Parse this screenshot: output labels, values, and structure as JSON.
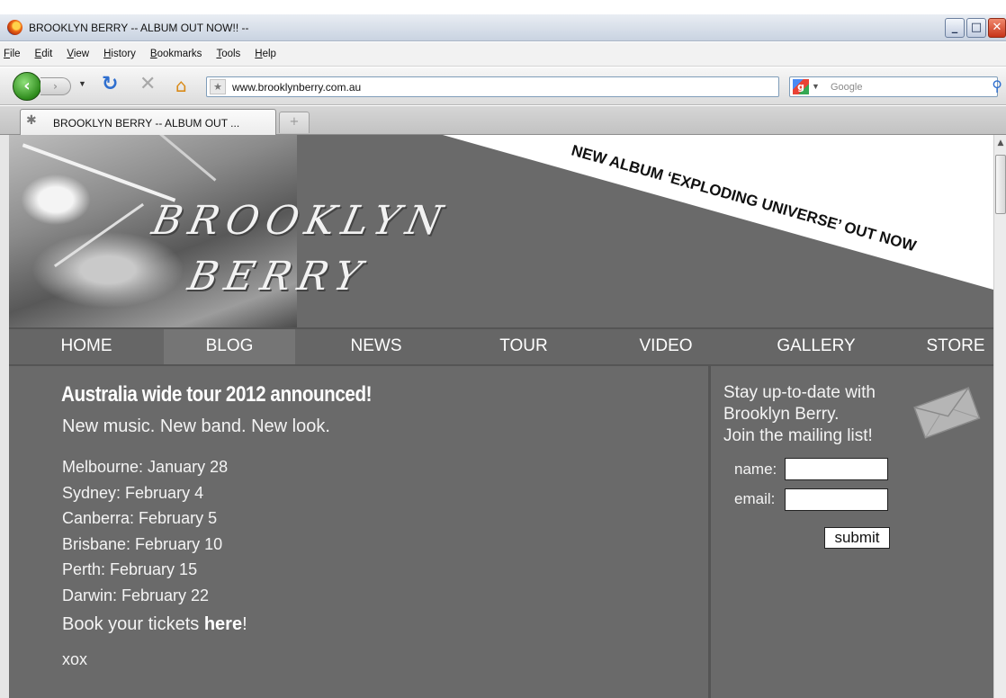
{
  "browser": {
    "window_title": "BROOKLYN BERRY -- ALBUM OUT NOW!! --",
    "window_buttons": {
      "minimize": "_",
      "maximize": "□",
      "close": "✕"
    },
    "menu": [
      "File",
      "Edit",
      "View",
      "History",
      "Bookmarks",
      "Tools",
      "Help"
    ],
    "url": "www.brooklynberry.com.au",
    "search_placeholder": "Google",
    "tab_title": "BROOKLYN BERRY -- ALBUM OUT ...",
    "icons": {
      "back": "back-arrow-icon",
      "forward": "forward-arrow-icon",
      "reload": "reload-icon",
      "stop": "stop-icon",
      "home": "home-icon",
      "rss": "rss-icon",
      "bookmark": "star-icon",
      "search_engine": "google-icon",
      "search": "magnifier-icon"
    }
  },
  "site": {
    "logo_line1": "BROOKLYN",
    "logo_line2": "BERRY",
    "banner": "NEW ALBUM ‘EXPLODING UNIVERSE’ OUT NOW",
    "nav": [
      "HOME",
      "BLOG",
      "NEWS",
      "TOUR",
      "VIDEO",
      "GALLERY",
      "STORE"
    ],
    "active_nav": "BLOG",
    "post": {
      "title": "Australia wide tour 2012 announced!",
      "subtitle": "New music. New band. New look.",
      "dates": [
        "Melbourne: January 28",
        "Sydney: February 4",
        "Canberra: February 5",
        "Brisbane: February 10",
        "Perth: February 15",
        "Darwin: February 22"
      ],
      "book_prefix": "Book your tickets ",
      "book_link": "here",
      "book_suffix": "!",
      "signoff": "xox"
    },
    "mailing": {
      "intro": [
        "Stay up-to-date with",
        "Brooklyn Berry.",
        "Join the mailing list!"
      ],
      "name_label": "name:",
      "email_label": "email:",
      "submit": "submit"
    },
    "colors": {
      "page_bg": "#6a6a6a",
      "text": "#ffffff",
      "banner_bg": "#ffffff",
      "banner_text": "#111111"
    }
  }
}
